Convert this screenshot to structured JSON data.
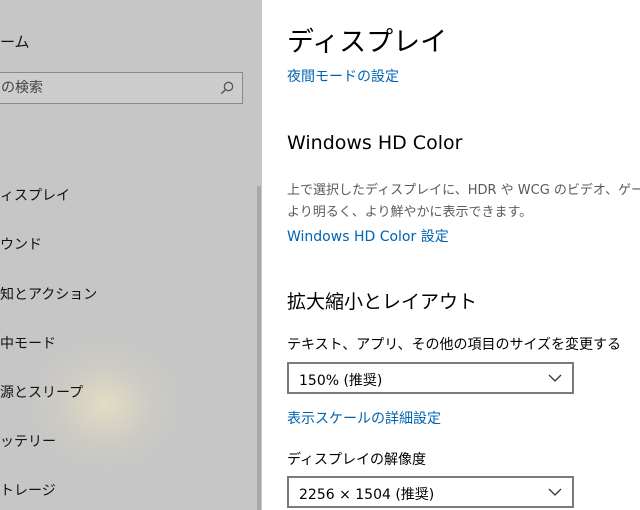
{
  "sidebar": {
    "home_label": "ーム",
    "search": {
      "placeholder": "の検索"
    },
    "items": [
      {
        "label": "ィスプレイ"
      },
      {
        "label": "ウンド"
      },
      {
        "label": "知とアクション"
      },
      {
        "label": "中モード"
      },
      {
        "label": "源とスリープ"
      },
      {
        "label": "ッテリー"
      },
      {
        "label": "トレージ"
      }
    ]
  },
  "main": {
    "title": "ディスプレイ",
    "night_light_link": "夜間モードの設定",
    "hd_color": {
      "title": "Windows HD Color",
      "description_line1": "上で選択したディスプレイに、HDR や WCG のビデオ、ゲーム",
      "description_line2": "より明るく、より鮮やかに表示できます。",
      "settings_link": "Windows HD Color 設定"
    },
    "scale_layout": {
      "title": "拡大縮小とレイアウト",
      "size_label": "テキスト、アプリ、その他の項目のサイズを変更する",
      "size_value": "150% (推奨)",
      "advanced_scale_link": "表示スケールの詳細設定",
      "resolution_label": "ディスプレイの解像度",
      "resolution_value": "2256 × 1504 (推奨)"
    }
  },
  "colors": {
    "link": "#0063b1",
    "sidebar_background": "#c6c6c6",
    "dropdown_border": "#7a7a7a"
  }
}
